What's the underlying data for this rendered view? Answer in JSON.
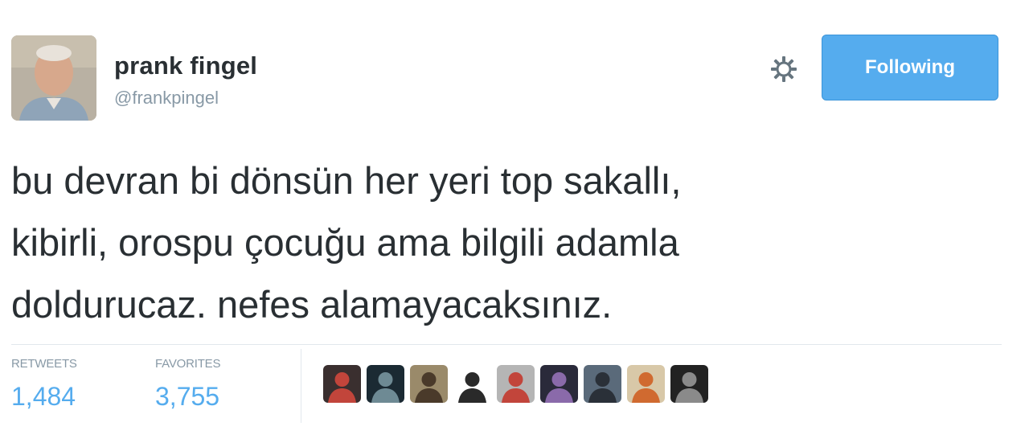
{
  "user": {
    "name": "prank fingel",
    "handle": "@frankpingel"
  },
  "actions": {
    "follow_label": "Following"
  },
  "tweet": {
    "text": "bu devran bi dönsün her yeri top sakallı,\nkibirli, orospu çocuğu ama bilgili adamla\ndoldurucaz. nefes alamayacaksınız."
  },
  "stats": {
    "retweets_label": "RETWEETS",
    "retweets_count": "1,484",
    "favorites_label": "FAVORITES",
    "favorites_count": "3,755"
  },
  "favoriters": [
    {
      "icon": "user-avatar",
      "bg": "#3a2f2f",
      "fg": "#c2453b"
    },
    {
      "icon": "user-avatar",
      "bg": "#1b2a33",
      "fg": "#6e8a94"
    },
    {
      "icon": "user-avatar",
      "bg": "#9a8a6a",
      "fg": "#4a3a2a"
    },
    {
      "icon": "user-avatar",
      "bg": "#ffffff",
      "fg": "#2a2a2a"
    },
    {
      "icon": "user-avatar",
      "bg": "#b5b5b5",
      "fg": "#c2453b"
    },
    {
      "icon": "user-avatar",
      "bg": "#2a2a3a",
      "fg": "#8a6aaa"
    },
    {
      "icon": "user-avatar",
      "bg": "#5a6a7a",
      "fg": "#2a3038"
    },
    {
      "icon": "user-avatar",
      "bg": "#d8c8a8",
      "fg": "#d06a30"
    },
    {
      "icon": "user-avatar",
      "bg": "#222222",
      "fg": "#8a8a8a"
    }
  ],
  "colors": {
    "accent": "#55acee",
    "muted": "#8899a6",
    "text": "#292f33",
    "divider": "#e1e8ed"
  }
}
